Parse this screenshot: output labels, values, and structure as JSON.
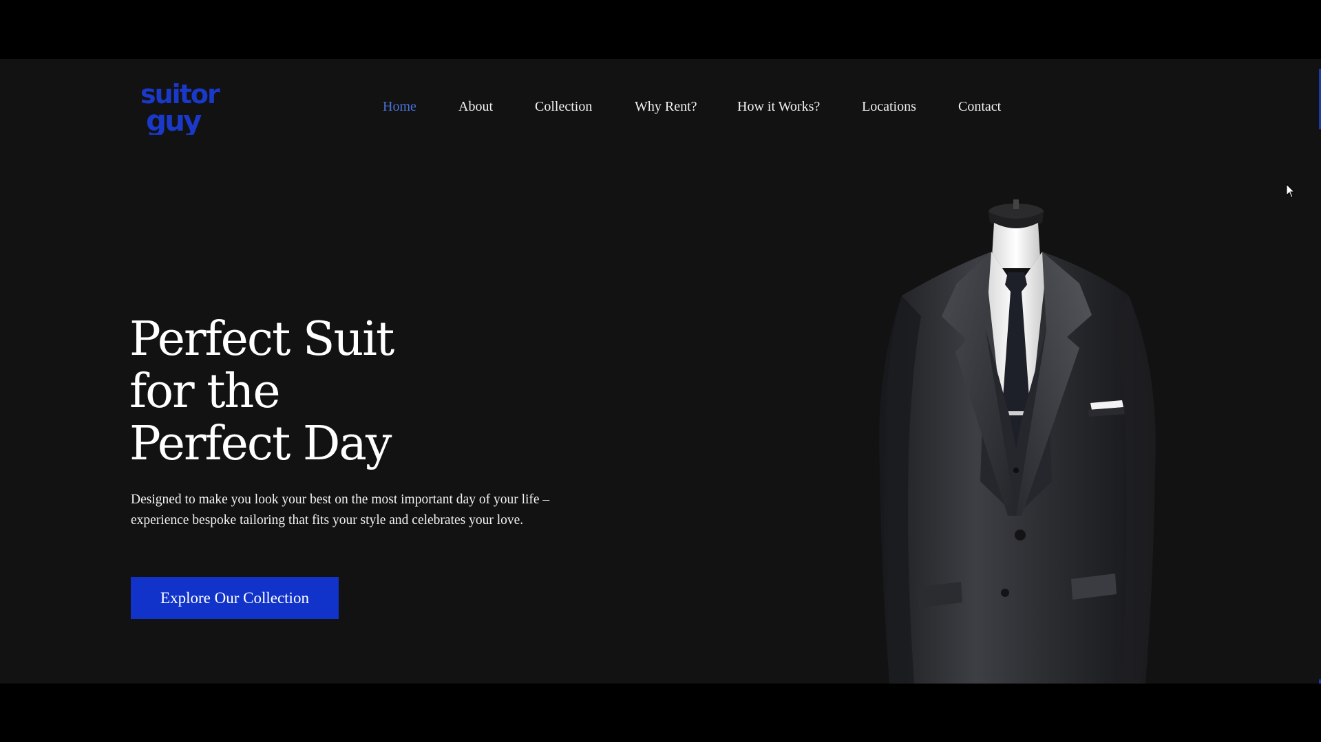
{
  "brand": {
    "logo_text_line1": "suitor",
    "logo_text_line2": "guy",
    "logo_color": "#1a39c9"
  },
  "nav": {
    "items": [
      {
        "label": "Home",
        "active": true
      },
      {
        "label": "About"
      },
      {
        "label": "Collection"
      },
      {
        "label": "Why Rent?"
      },
      {
        "label": "How it Works?"
      },
      {
        "label": "Locations"
      },
      {
        "label": "Contact"
      }
    ],
    "active_color": "#4a72d8"
  },
  "hero": {
    "title_lines": [
      "Perfect Suit",
      "for the",
      "Perfect Day"
    ],
    "subtitle": "Designed to make you look your best on the most important day of your life – experience bespoke tailoring that fits your style and celebrates your love.",
    "cta_label": "Explore Our Collection",
    "cta_color": "#1133c9",
    "image_icon": "suit-mannequin-image"
  },
  "colors": {
    "page_bg": "#121212",
    "letterbox": "#000000",
    "text": "#f2f2f2"
  }
}
